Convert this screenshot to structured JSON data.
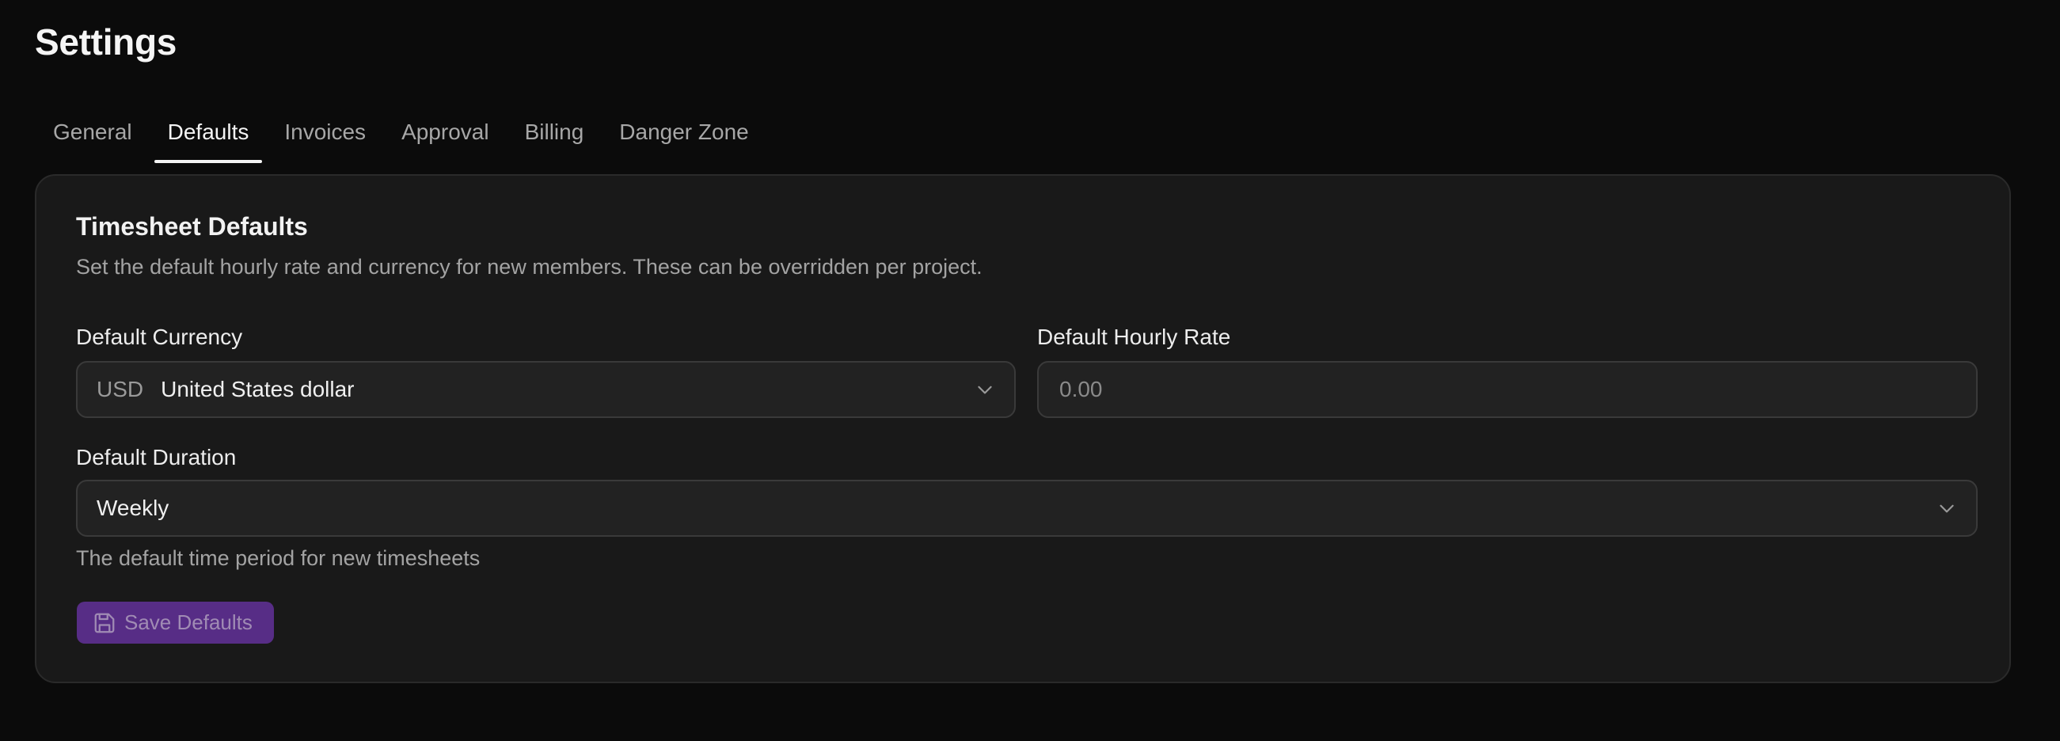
{
  "page": {
    "title": "Settings"
  },
  "tabs": [
    {
      "label": "General",
      "active": false
    },
    {
      "label": "Defaults",
      "active": true
    },
    {
      "label": "Invoices",
      "active": false
    },
    {
      "label": "Approval",
      "active": false
    },
    {
      "label": "Billing",
      "active": false
    },
    {
      "label": "Danger Zone",
      "active": false
    }
  ],
  "card": {
    "title": "Timesheet Defaults",
    "description": "Set the default hourly rate and currency for new members. These can be overridden per project."
  },
  "currency": {
    "label": "Default Currency",
    "code": "USD",
    "name": "United States dollar"
  },
  "rate": {
    "label": "Default Hourly Rate",
    "placeholder": "0.00",
    "value": ""
  },
  "duration": {
    "label": "Default Duration",
    "value": "Weekly",
    "helper": "The default time period for new timesheets"
  },
  "save": {
    "label": "Save Defaults",
    "icon": "save-icon"
  },
  "colors": {
    "background": "#0b0b0b",
    "card": "#191919",
    "accent": "#5b2f8c"
  }
}
